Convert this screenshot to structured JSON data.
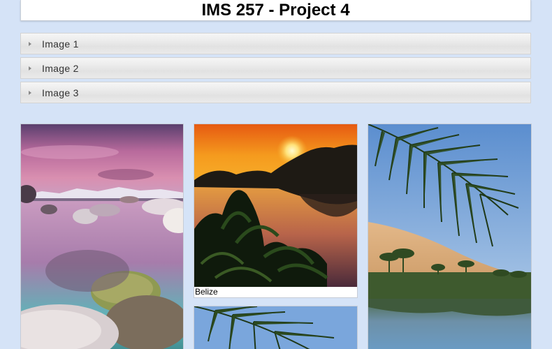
{
  "header": {
    "title": "IMS 257 - Project 4"
  },
  "accordion": {
    "items": [
      {
        "label": "Image 1"
      },
      {
        "label": "Image 2"
      },
      {
        "label": "Image 3"
      }
    ]
  },
  "gallery": {
    "cards": [
      {
        "caption": ""
      },
      {
        "caption": "Belize"
      },
      {
        "caption": ""
      },
      {
        "caption": ""
      }
    ]
  }
}
